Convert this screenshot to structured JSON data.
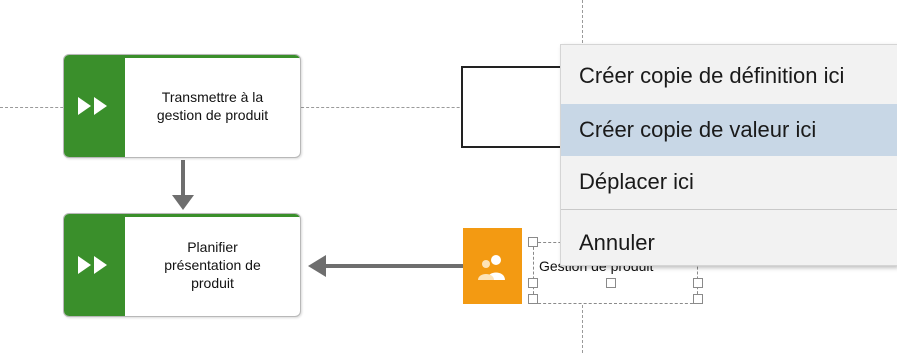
{
  "diagram": {
    "processes": [
      {
        "label": "Transmettre à la\ngestion de produit",
        "icon": "fast-forward-icon"
      },
      {
        "label": "Planifier\nprésentation de\nproduit",
        "icon": "fast-forward-icon"
      }
    ],
    "org_unit": {
      "label": "Gestion de produit",
      "icon": "people-group-icon"
    }
  },
  "context_menu": {
    "items": [
      {
        "label": "Créer copie de définition ici",
        "highlighted": false
      },
      {
        "label": "Créer copie de valeur ici",
        "highlighted": true
      },
      {
        "label": "Déplacer ici",
        "highlighted": false
      },
      {
        "label": "Annuler",
        "highlighted": false
      }
    ]
  },
  "colors": {
    "process_green": "#3a8f2b",
    "org_orange": "#f39a12",
    "menu_highlight": "#c8d7e6",
    "arrow_gray": "#6e6e6e"
  }
}
